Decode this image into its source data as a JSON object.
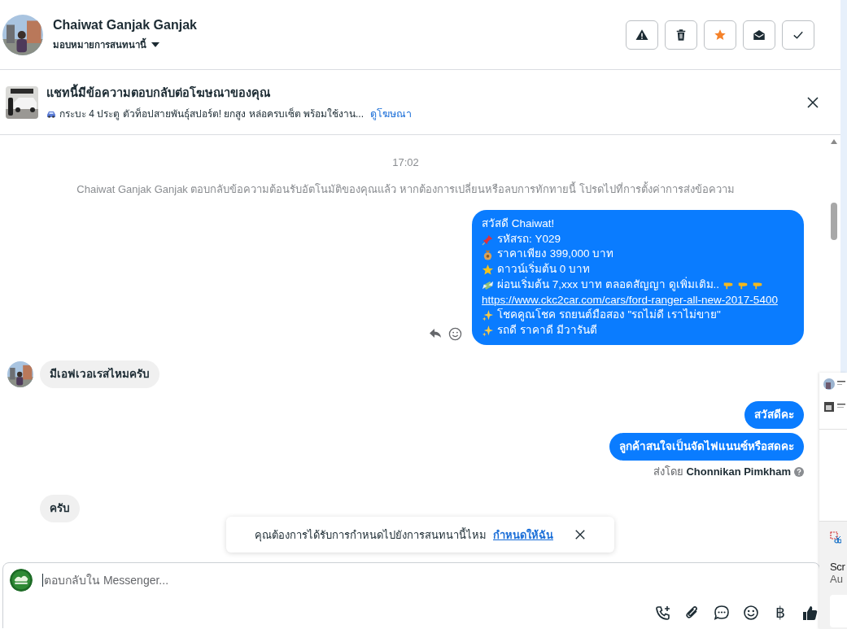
{
  "header": {
    "name": "Chaiwat Ganjak Ganjak",
    "assign_label": "มอบหมายการสนทนานี้",
    "actions": [
      {
        "kind": "spam"
      },
      {
        "kind": "delete"
      },
      {
        "kind": "star",
        "on": true
      },
      {
        "kind": "unread"
      },
      {
        "kind": "done"
      }
    ]
  },
  "ad_banner": {
    "title": "แชทนี้มีข้อความตอบกลับต่อโฆษณาของคุณ",
    "snippet": "กระบะ 4 ประตู ตัวท็อปสายพันธุ์สปอร์ต! ยกสูง หล่อครบเซ็ต พร้อมใช้งาน...",
    "link": "ดูโฆษณา"
  },
  "messages": [
    {
      "kind": "time",
      "text": "17:02"
    },
    {
      "kind": "notice",
      "text": "Chaiwat Ganjak Ganjak ตอบกลับข้อความต้อนรับอัตโนมัติของคุณแล้ว หากต้องการเปลี่ยนหรือลบการทักทายนี้ โปรดไปที่การตั้งค่าการส่งข้อความ"
    },
    {
      "kind": "rich",
      "lines": [
        {
          "kind": "plain",
          "text": "สวัสดี Chaiwat!"
        },
        {
          "kind": "pin",
          "text": "รหัสรถ: Y029"
        },
        {
          "kind": "bag",
          "text": "ราคาเพียง 399,000 บาท"
        },
        {
          "kind": "star",
          "text": "ดาวน์เริ่มต้น 0 บาท"
        },
        {
          "kind": "cash",
          "text": "ผ่อนเริ่มต้น 7,xxx บาท ตลอดสัญญา ดูเพิ่มเติม.."
        },
        {
          "kind": "link",
          "text": "https://www.ckc2car.com/cars/ford-ranger-all-new-2017-5400"
        },
        {
          "kind": "sparkle",
          "text": "โชคคูณโชค รถยนต์มือสอง \"รถไม่ดี เราไม่ขาย\""
        },
        {
          "kind": "sparkle",
          "text": "รถดี ราคาดี มีวารันตี"
        }
      ]
    },
    {
      "kind": "incoming",
      "avatar": true,
      "text": "มีเอฟเวอเรสไหมครับ"
    },
    {
      "kind": "outgoing",
      "text": "สวัสดีคะ"
    },
    {
      "kind": "outgoing",
      "text": "ลูกค้าสนใจเป็นจัดไฟแนนซ์หรือสดคะ"
    },
    {
      "kind": "sent_by",
      "text": "ส่งโดย **Chonnikan Pimkham**"
    },
    {
      "kind": "incoming",
      "avatar": false,
      "text": "ครับ"
    }
  ],
  "toast": {
    "text": "คุณต้องการได้รับการกำหนดไปยังการสนทนานี้ไหม",
    "link": "กำหนดให้ฉัน"
  },
  "composer": {
    "placeholder": "ตอบกลับใน Messenger...",
    "tools": [
      {
        "kind": "call"
      },
      {
        "kind": "attach"
      },
      {
        "kind": "saved"
      },
      {
        "kind": "emoji"
      },
      {
        "kind": "currency",
        "glyph": "฿"
      },
      {
        "kind": "like"
      }
    ]
  },
  "notification": {
    "title": "Scr",
    "subtitle": "Au"
  }
}
